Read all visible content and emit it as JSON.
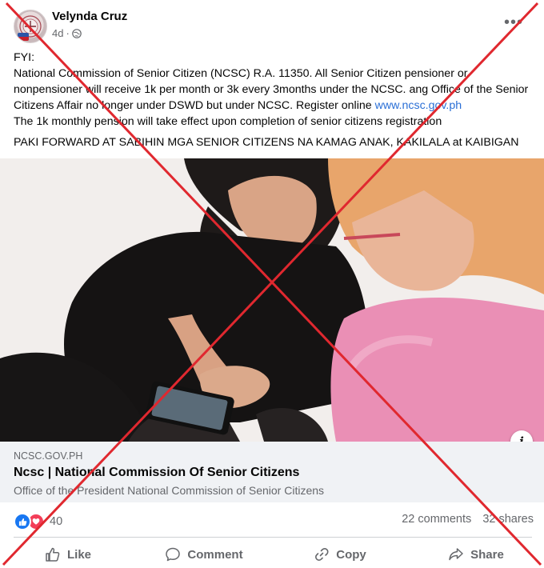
{
  "post": {
    "author": "Velynda Cruz",
    "time": "4d",
    "separator": "·",
    "privacy_icon": "globe-icon",
    "more_icon": "more-options-icon"
  },
  "text": {
    "line1": "FYI:",
    "para_before_link": "National Commission of Senior Citizen (NCSC) R.A. 11350. All Senior Citizen pensioner or nonpensioner will receive 1k per month or 3k every 3months under the NCSC.  ang Office of the Senior Citizens Affair no longer under DSWD but under NCSC. Register online ",
    "link": "www.ncsc.gov.ph",
    "para_after_link": "The 1k monthly pension will take effect upon completion of senior citizens registration",
    "forward": "PAKI FORWARD AT SABIHIN MGA SENIOR CITIZENS NA KAMAG ANAK, KAKILALA at KAIBIGAN"
  },
  "preview": {
    "domain": "NCSC.GOV.PH",
    "title": "Ncsc | National Commission Of Senior Citizens",
    "subtitle": "Office of the President National Commission of Senior Citizens",
    "info_label": "i"
  },
  "stats": {
    "reaction_count": "40",
    "comments": "22 comments",
    "shares": "32 shares"
  },
  "actions": {
    "like": "Like",
    "comment": "Comment",
    "copy": "Copy",
    "share": "Share"
  },
  "colors": {
    "link": "#2a6fd6",
    "like_blue": "#1877f2",
    "love_red": "#f33e58",
    "overlay_x": "#e0282f"
  }
}
